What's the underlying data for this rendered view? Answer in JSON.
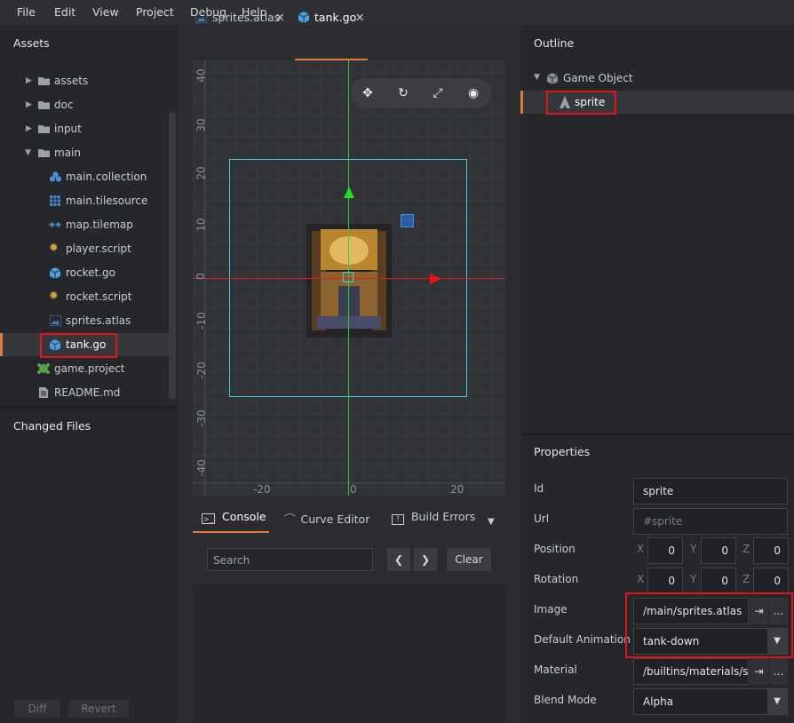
{
  "menu": [
    "File",
    "Edit",
    "View",
    "Project",
    "Debug",
    "Help"
  ],
  "assets": {
    "title": "Assets",
    "items": [
      {
        "label": "assets",
        "icon": "folder-icon"
      },
      {
        "label": "doc",
        "icon": "folder-icon"
      },
      {
        "label": "input",
        "icon": "folder-icon"
      },
      {
        "label": "main",
        "icon": "folder-open-icon"
      },
      {
        "label": "main.collection",
        "icon": "collection-icon"
      },
      {
        "label": "main.tilesource",
        "icon": "tilesource-icon"
      },
      {
        "label": "map.tilemap",
        "icon": "tilemap-icon"
      },
      {
        "label": "player.script",
        "icon": "script-gear-icon"
      },
      {
        "label": "rocket.go",
        "icon": "gameobject-cube-icon"
      },
      {
        "label": "rocket.script",
        "icon": "script-gear-icon"
      },
      {
        "label": "sprites.atlas",
        "icon": "atlas-icon"
      },
      {
        "label": "tank.go",
        "icon": "gameobject-cube-icon"
      },
      {
        "label": "game.project",
        "icon": "project-icon"
      },
      {
        "label": "README.md",
        "icon": "document-icon"
      }
    ]
  },
  "changed_files": {
    "title": "Changed Files",
    "diff": "Diff",
    "revert": "Revert"
  },
  "tabs": [
    {
      "label": "sprites.atlas"
    },
    {
      "label": "tank.go"
    }
  ],
  "scene": {
    "y_ticks": [
      "40",
      "30",
      "20",
      "10",
      "0",
      "-10",
      "-20",
      "-30",
      "-40"
    ],
    "x_ticks": [
      "-20",
      "0",
      "20"
    ]
  },
  "console": {
    "tabs": [
      "Console",
      "Curve Editor",
      "Build Errors"
    ],
    "search_placeholder": "Search",
    "clear": "Clear"
  },
  "outline": {
    "title": "Outline",
    "root": "Game Object",
    "child": "sprite"
  },
  "properties": {
    "title": "Properties",
    "id_label": "Id",
    "id": "sprite",
    "url_label": "Url",
    "url": "#sprite",
    "position_label": "Position",
    "position": {
      "x": "0",
      "y": "0",
      "z": "0"
    },
    "rotation_label": "Rotation",
    "rotation": {
      "x": "0",
      "y": "0",
      "z": "0"
    },
    "axis": {
      "x": "X",
      "y": "Y",
      "z": "Z"
    },
    "image_label": "Image",
    "image": "/main/sprites.atlas",
    "anim_label": "Default Animation",
    "anim": "tank-down",
    "material_label": "Material",
    "material": "/builtins/materials/s",
    "blend_label": "Blend Mode",
    "blend": "Alpha"
  },
  "colors": {
    "accent": "#e0793a",
    "highlight": "#e3141b",
    "axis_x": "#e02020",
    "axis_y": "#33cc33",
    "bounds": "#3fd0d8"
  }
}
